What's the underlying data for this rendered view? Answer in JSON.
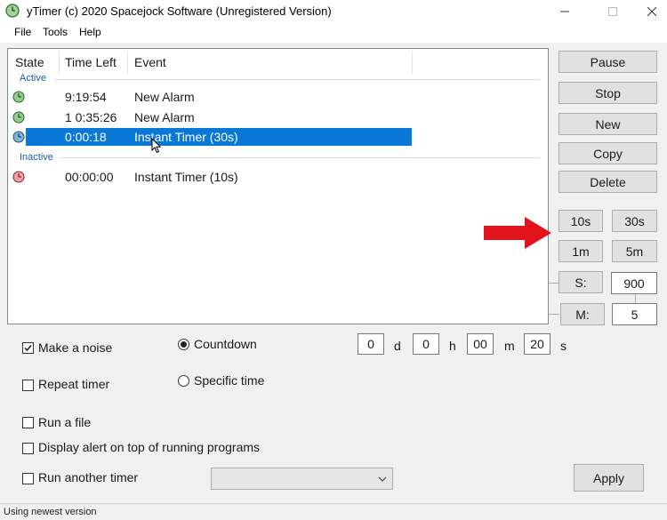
{
  "window": {
    "title": "yTimer (c) 2020 Spacejock Software (Unregistered Version)",
    "icons": {
      "minimize": "minimize-icon",
      "maximize": "maximize-icon",
      "close": "close-icon"
    }
  },
  "menu": {
    "file": "File",
    "tools": "Tools",
    "help": "Help"
  },
  "list": {
    "columns": {
      "state": "State",
      "time_left": "Time Left",
      "event": "Event"
    },
    "groups": {
      "active": {
        "label": "Active",
        "rows": [
          {
            "time_left": "9:19:54",
            "event": "New Alarm",
            "icon": "clock-green-icon",
            "selected": false
          },
          {
            "time_left": "1 0:35:26",
            "event": "New Alarm",
            "icon": "clock-green-icon",
            "selected": false
          },
          {
            "time_left": "0:00:18",
            "event": "Instant Timer (30s)",
            "icon": "clock-blue-icon",
            "selected": true
          }
        ]
      },
      "inactive": {
        "label": "Inactive",
        "rows": [
          {
            "time_left": "00:00:00",
            "event": "Instant Timer (10s)",
            "icon": "clock-red-icon",
            "selected": false
          }
        ]
      }
    }
  },
  "buttons": {
    "pause": "Pause",
    "stop": "Stop",
    "new": "New",
    "copy": "Copy",
    "delete": "Delete",
    "q10s": "10s",
    "q30s": "30s",
    "q1m": "1m",
    "q5m": "5m",
    "s": "S:",
    "m": "M:",
    "apply": "Apply"
  },
  "quick_fields": {
    "seconds": "900",
    "minutes": "5"
  },
  "options": {
    "make_noise": {
      "label": "Make a noise",
      "checked": true
    },
    "repeat_timer": {
      "label": "Repeat timer",
      "checked": false
    },
    "run_file": {
      "label": "Run a file",
      "checked": false
    },
    "display_alert": {
      "label": "Display alert on top of running programs",
      "checked": false
    },
    "run_another": {
      "label": "Run another timer",
      "checked": false
    }
  },
  "mode": {
    "countdown": {
      "label": "Countdown",
      "selected": true
    },
    "specific_time": {
      "label": "Specific time",
      "selected": false
    }
  },
  "duration": {
    "days": "0",
    "days_unit": "d",
    "hours": "0",
    "hours_unit": "h",
    "minutes": "00",
    "minutes_unit": "m",
    "seconds": "20",
    "seconds_unit": "s"
  },
  "status": {
    "text": "Using newest version"
  },
  "colors": {
    "selection": "#0a78d7",
    "group_label": "#1e5aa8",
    "arrow": "#e0141a"
  }
}
